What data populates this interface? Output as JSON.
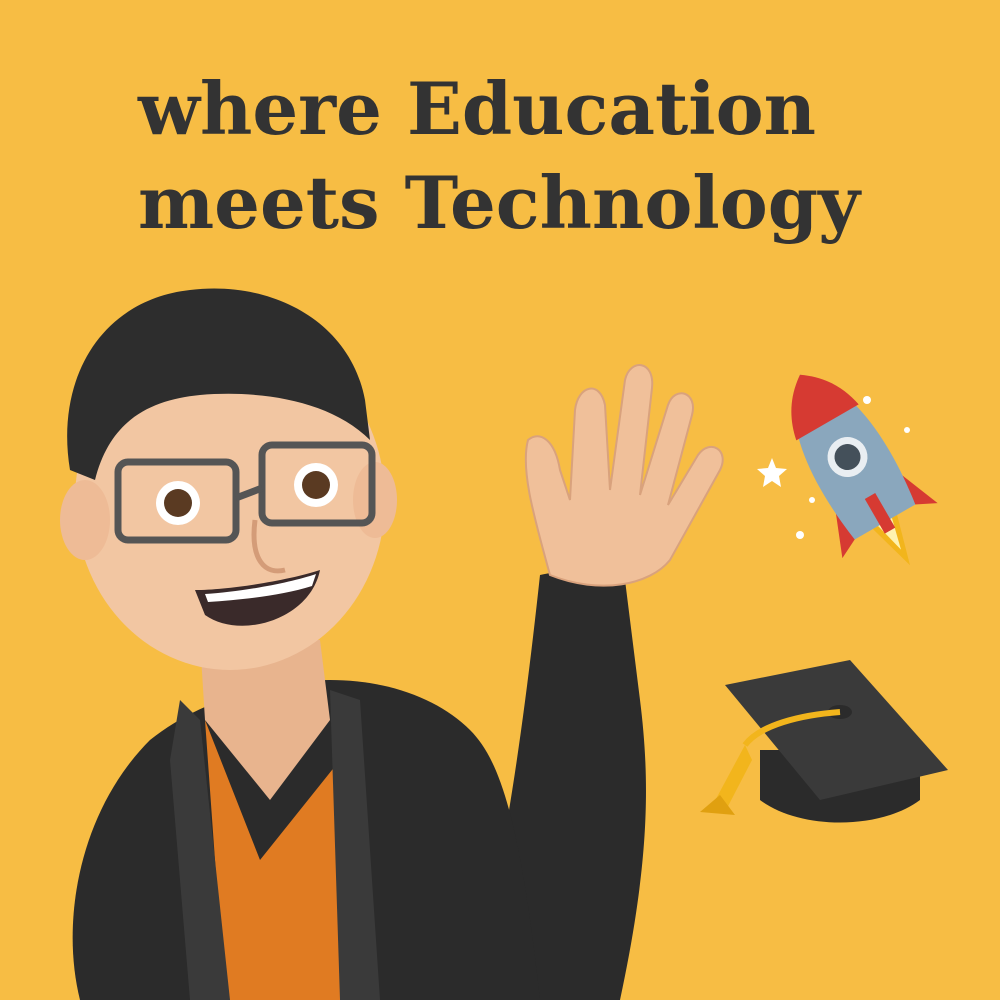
{
  "headline": {
    "line1": "where Education",
    "line2": "meets Technology"
  },
  "colors": {
    "background": "#f7bd44",
    "text": "#333333",
    "jacket": "#2b2b2b",
    "shirt": "#e07b22",
    "skin": "#f2c6a2",
    "hair": "#2d2d2d",
    "rocket_body": "#8aa7bd",
    "rocket_red": "#d63a32",
    "cap": "#333333",
    "tassel": "#f2b51c"
  },
  "icons": [
    "memoji-avatar",
    "rocket-icon",
    "graduation-cap-icon",
    "star-icon"
  ]
}
